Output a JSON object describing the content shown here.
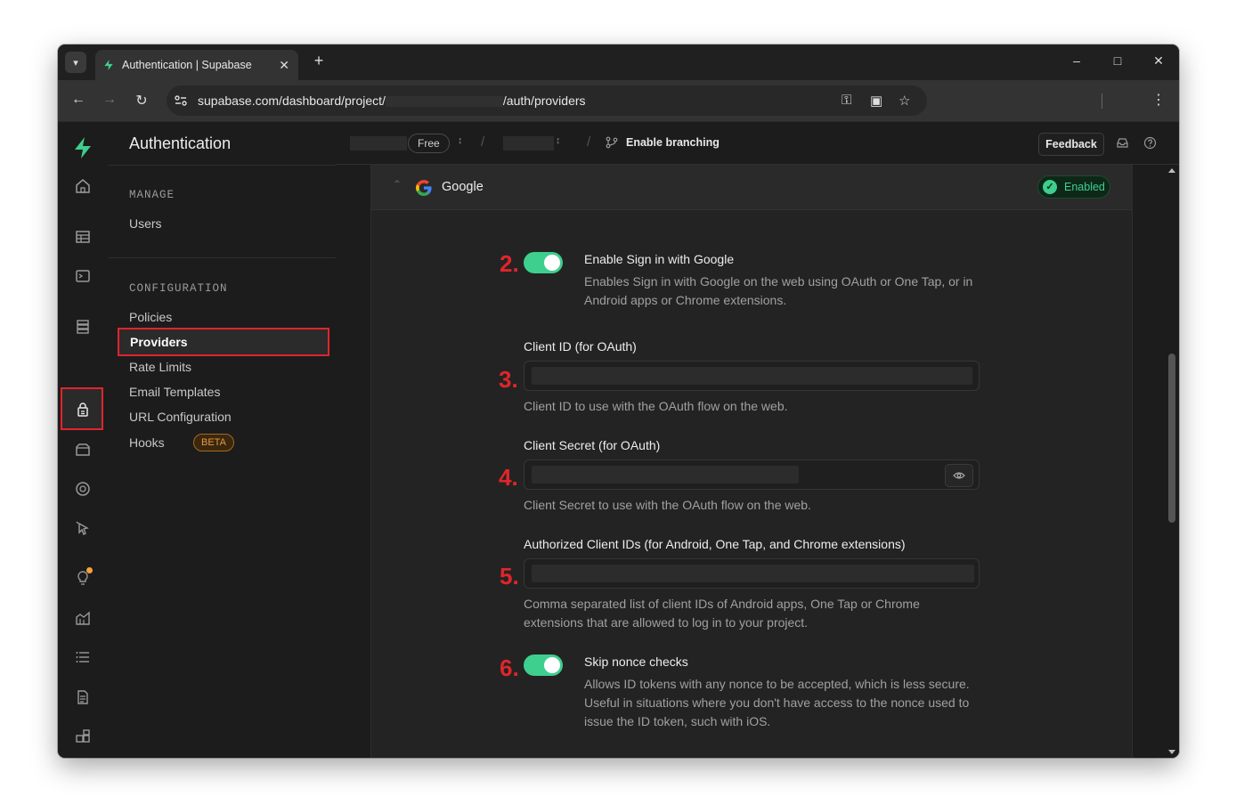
{
  "browser": {
    "tab_title": "Authentication | Supabase",
    "url_prefix": "supabase.com/dashboard/project/",
    "url_suffix": "/auth/providers"
  },
  "sidebar": {
    "title": "Authentication",
    "manage_heading": "MANAGE",
    "manage_items": [
      "Users"
    ],
    "config_heading": "CONFIGURATION",
    "config_items": [
      "Policies",
      "Providers",
      "Rate Limits",
      "Email Templates",
      "URL Configuration",
      "Hooks"
    ],
    "active_item": "Providers",
    "beta_label": "BETA"
  },
  "topbar": {
    "plan": "Free",
    "branching": "Enable branching",
    "feedback": "Feedback"
  },
  "provider": {
    "name": "Google",
    "status": "Enabled",
    "fields": {
      "enable_label": "Enable Sign in with Google",
      "enable_desc": "Enables Sign in with Google on the web using OAuth or One Tap, or in Android apps or Chrome extensions.",
      "client_id_label": "Client ID (for OAuth)",
      "client_id_desc": "Client ID to use with the OAuth flow on the web.",
      "client_secret_label": "Client Secret (for OAuth)",
      "client_secret_desc": "Client Secret to use with the OAuth flow on the web.",
      "authorized_label": "Authorized Client IDs (for Android, One Tap, and Chrome extensions)",
      "authorized_desc": "Comma separated list of client IDs of Android apps, One Tap or Chrome extensions that are allowed to log in to your project.",
      "skip_nonce_label": "Skip nonce checks",
      "skip_nonce_desc": "Allows ID tokens with any nonce to be accepted, which is less secure. Useful in situations where you don't have access to the nonce used to issue the ID token, such with iOS."
    },
    "enable_on": true,
    "skip_nonce_on": true
  },
  "annotations": {
    "step2": "2.",
    "step3": "3.",
    "step4": "4.",
    "step5": "5.",
    "step6": "6."
  },
  "colors": {
    "accent": "#3ecf8e",
    "highlight": "#e0252b",
    "background": "#1c1c1c"
  }
}
